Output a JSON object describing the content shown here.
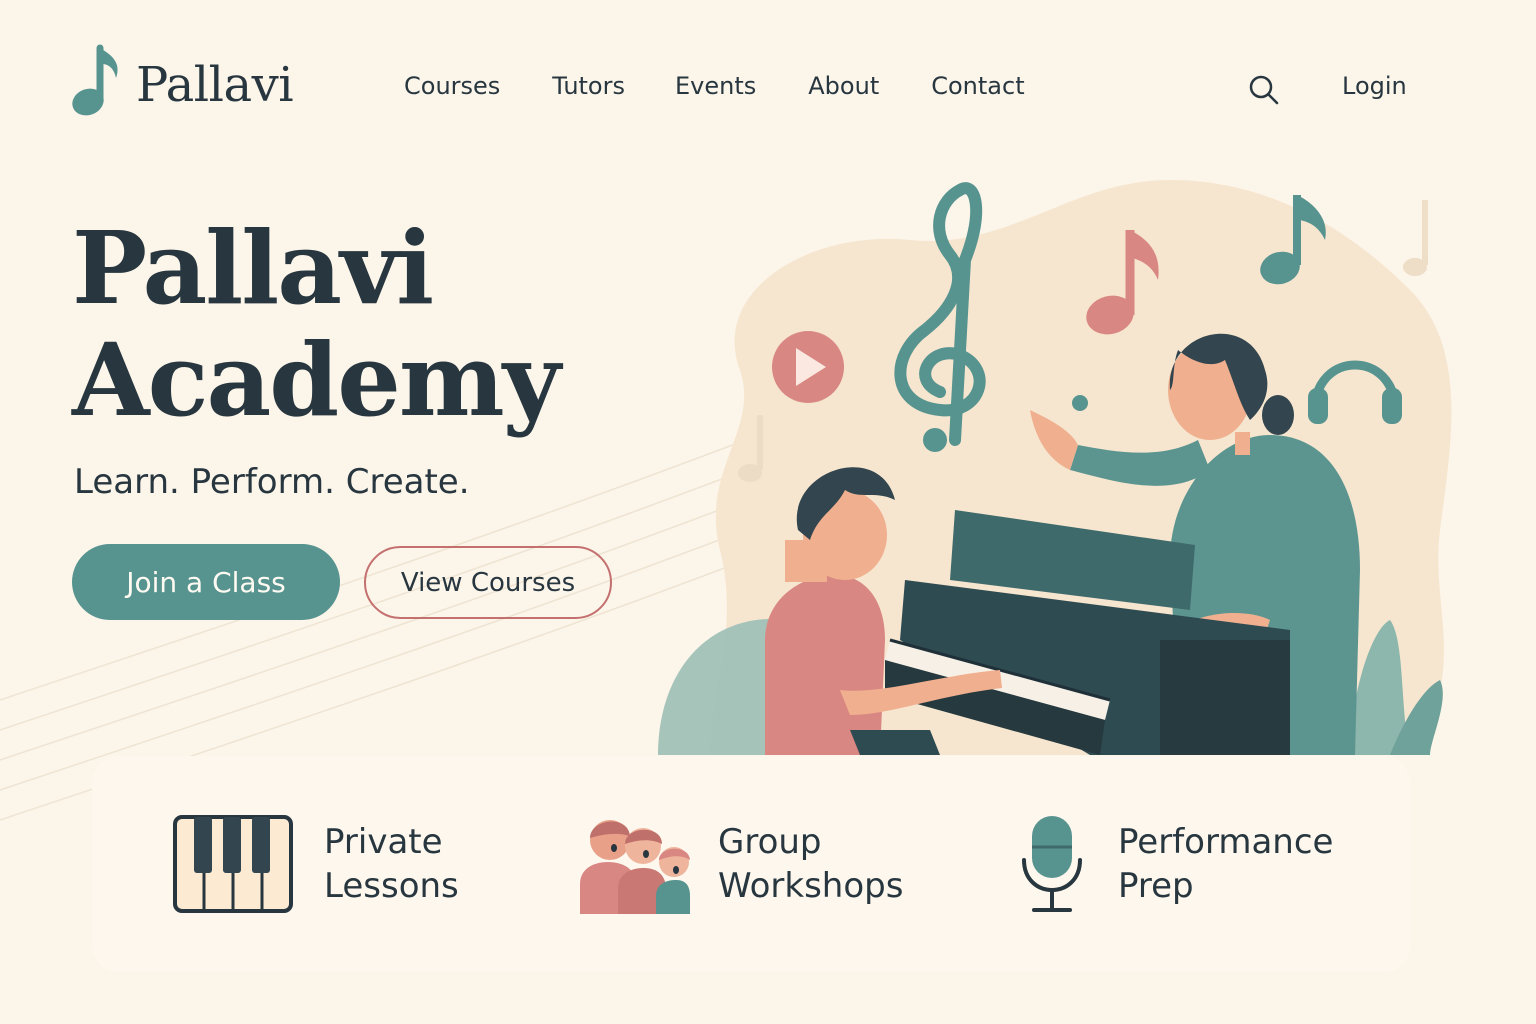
{
  "brand": {
    "name": "Pallavi",
    "logo_icon": "music-note-icon",
    "colors": {
      "background": "#fcf5ea",
      "primary_teal": "#579490",
      "accent_rose": "#d98783",
      "dark_text": "#27363f"
    }
  },
  "nav": {
    "items": [
      {
        "label": "Courses"
      },
      {
        "label": "Tutors"
      },
      {
        "label": "Events"
      },
      {
        "label": "About"
      },
      {
        "label": "Contact"
      }
    ],
    "search_icon": "search-icon",
    "login_label": "Login"
  },
  "hero": {
    "title_line1": "Pallavi",
    "title_line2": "Academy",
    "tagline": "Learn. Perform. Create.",
    "primary_cta": "Join a Class",
    "secondary_cta": "View Courses",
    "illustration_icons": [
      "treble-clef-icon",
      "music-note-icon",
      "play-icon",
      "headphones-icon"
    ]
  },
  "features": [
    {
      "icon": "piano-keys-icon",
      "line1": "Private",
      "line2": "Lessons"
    },
    {
      "icon": "group-singers-icon",
      "line1": "Group",
      "line2": "Workshops"
    },
    {
      "icon": "microphone-icon",
      "line1": "Performance",
      "line2": "Prep"
    }
  ]
}
